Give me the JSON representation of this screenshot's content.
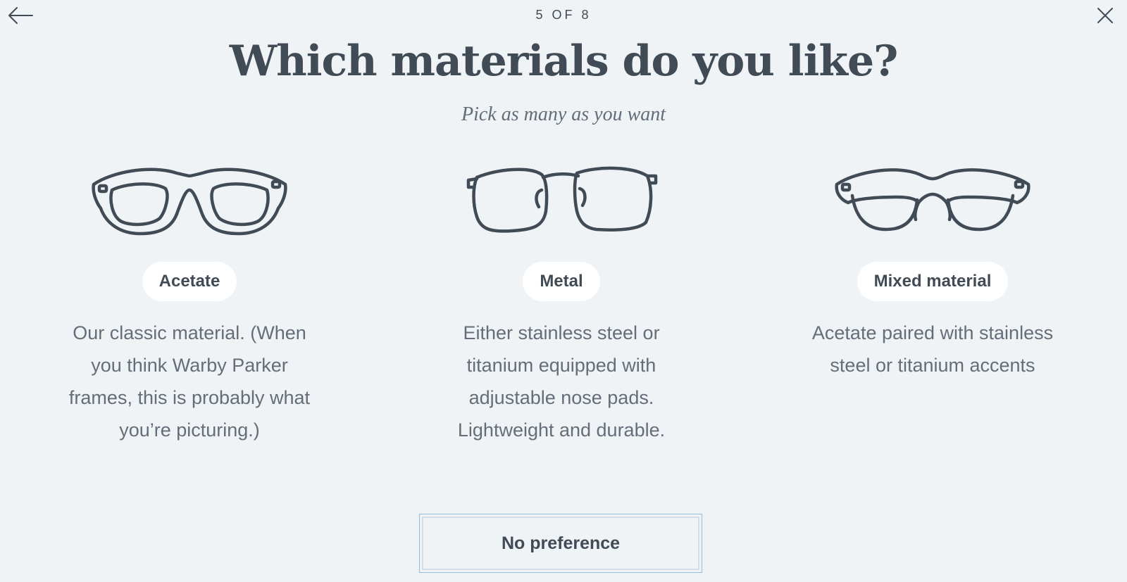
{
  "header": {
    "step_label": "5 OF 8",
    "back_icon": "arrow-left-icon",
    "close_icon": "close-icon"
  },
  "title": "Which materials do you like?",
  "subtitle": "Pick as many as you want",
  "options": [
    {
      "icon": "acetate-glasses-icon",
      "label": "Acetate",
      "description": "Our classic material. (When you think Warby Parker frames, this is probably what you’re picturing.)"
    },
    {
      "icon": "metal-glasses-icon",
      "label": "Metal",
      "description": "Either stainless steel or titanium equipped with adjustable nose pads. Lightweight and durable."
    },
    {
      "icon": "mixed-glasses-icon",
      "label": "Mixed material",
      "description": "Acetate paired with stainless steel or titanium accents"
    }
  ],
  "no_preference_label": "No preference",
  "colors": {
    "background": "#eff3f6",
    "text": "#414b56",
    "muted_text": "#656e78",
    "pill_bg": "#ffffff",
    "focus_border": "#8fbfd9"
  }
}
